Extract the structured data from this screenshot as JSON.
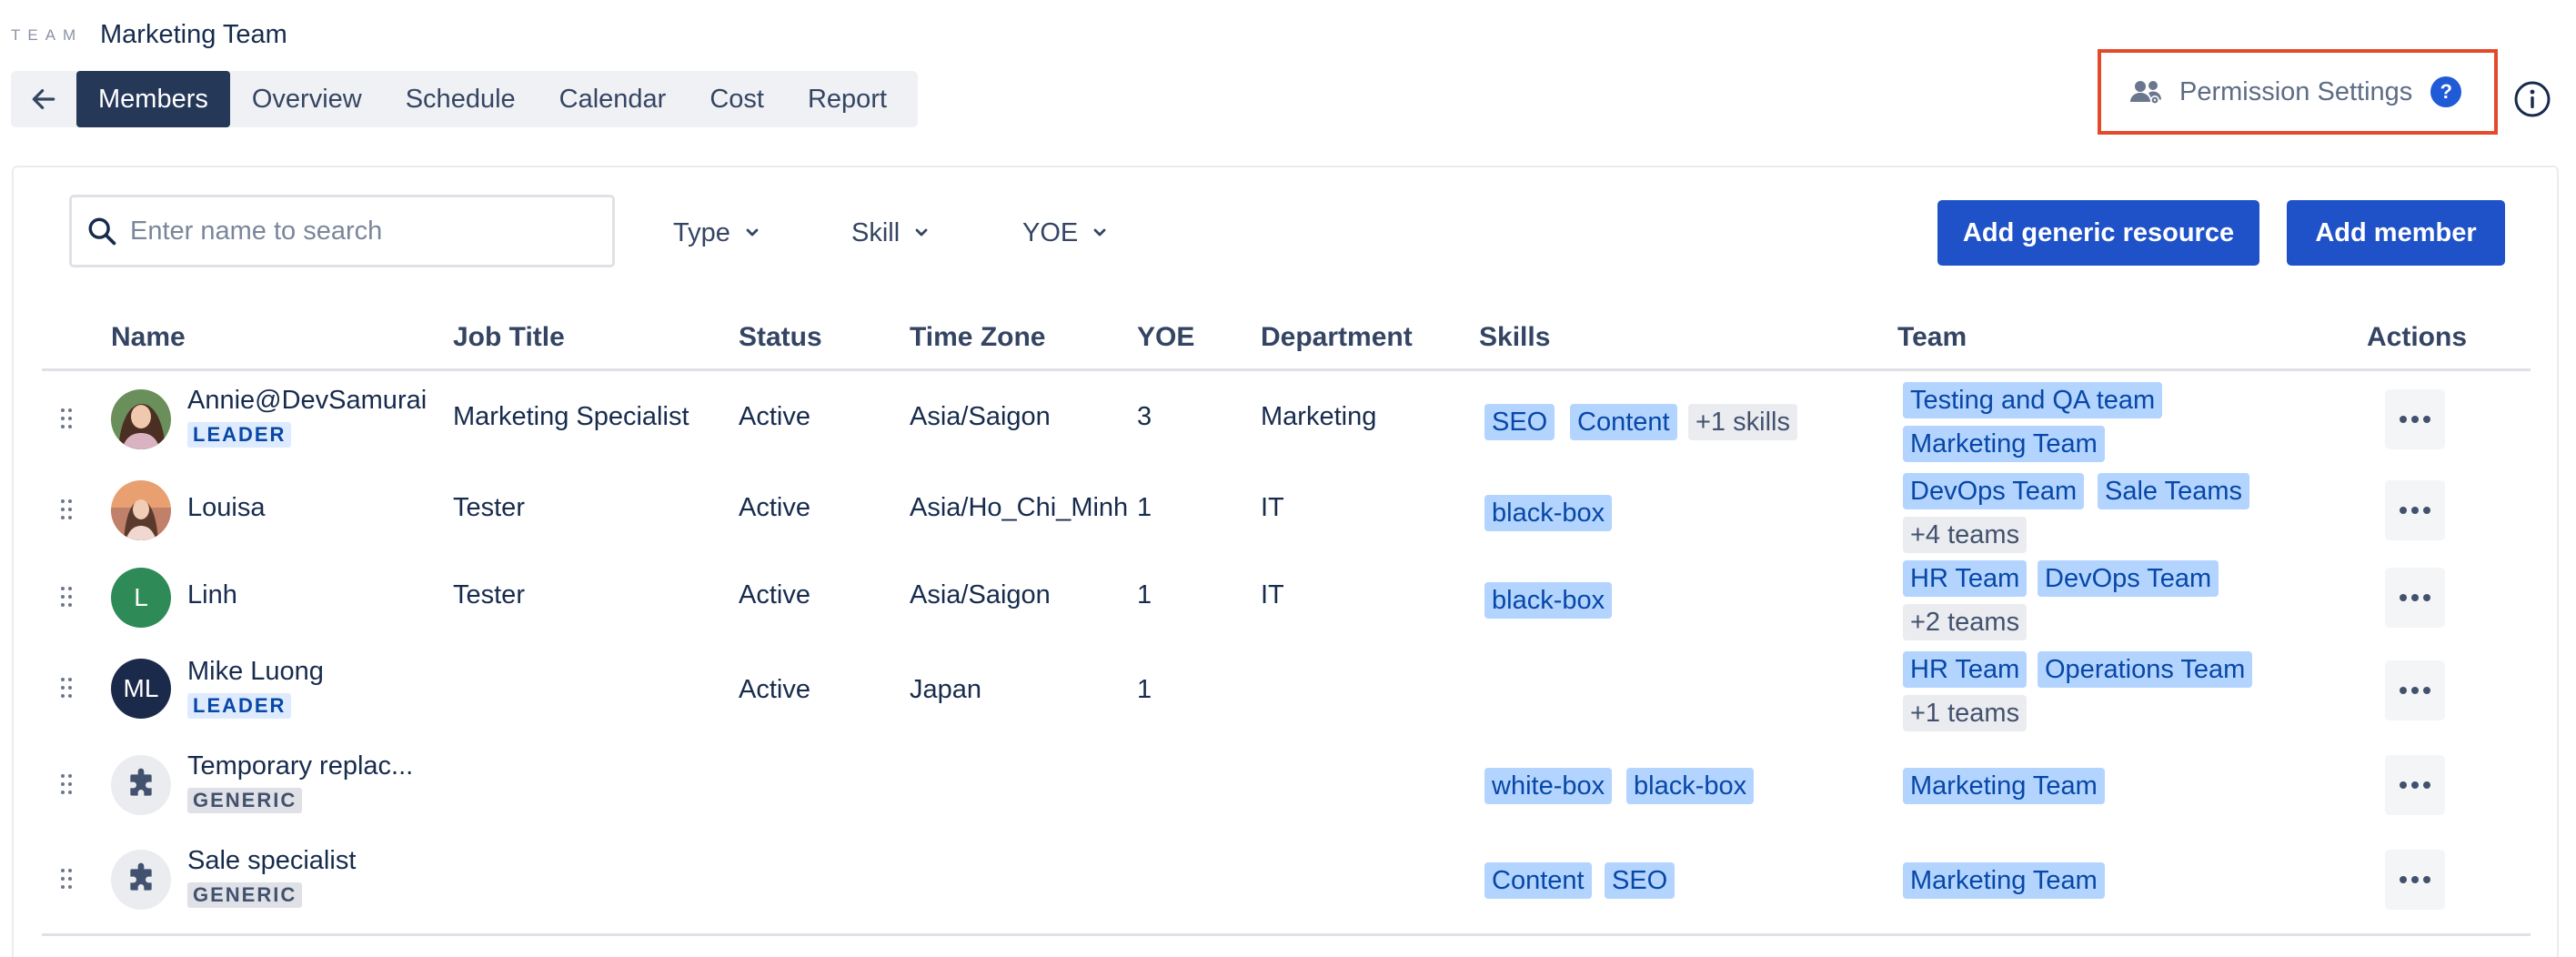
{
  "header": {
    "team_label": "TEAM",
    "team_name": "Marketing Team",
    "tabs": [
      {
        "label": "Members",
        "active": true
      },
      {
        "label": "Overview"
      },
      {
        "label": "Schedule"
      },
      {
        "label": "Calendar"
      },
      {
        "label": "Cost"
      },
      {
        "label": "Report"
      }
    ],
    "permission_settings_label": "Permission Settings",
    "help_badge": "?"
  },
  "toolbar": {
    "search_placeholder": "Enter name to search",
    "filters": [
      "Type",
      "Skill",
      "YOE"
    ],
    "add_generic_label": "Add generic resource",
    "add_member_label": "Add member"
  },
  "table": {
    "columns": [
      "Name",
      "Job Title",
      "Status",
      "Time Zone",
      "YOE",
      "Department",
      "Skills",
      "Team",
      "Actions"
    ],
    "rows": [
      {
        "name": "Annie@DevSamurai",
        "badge": "LEADER",
        "job_title": "Marketing Specialist",
        "status": "Active",
        "time_zone": "Asia/Saigon",
        "yoe": "3",
        "department": "Marketing",
        "skills": [
          "SEO",
          "Content"
        ],
        "skills_more": "+1 skills",
        "teams": [
          "Testing and QA team",
          "Marketing Team"
        ],
        "teams_more": ""
      },
      {
        "name": "Louisa",
        "badge": "",
        "job_title": "Tester",
        "status": "Active",
        "time_zone": "Asia/Ho_Chi_Minh",
        "yoe": "1",
        "department": "IT",
        "skills": [
          "black-box"
        ],
        "skills_more": "",
        "teams": [
          "DevOps Team",
          "Sale Teams"
        ],
        "teams_more": "+4 teams"
      },
      {
        "name": "Linh",
        "avatar_initial": "L",
        "badge": "",
        "job_title": "Tester",
        "status": "Active",
        "time_zone": "Asia/Saigon",
        "yoe": "1",
        "department": "IT",
        "skills": [
          "black-box"
        ],
        "skills_more": "",
        "teams": [
          "HR Team",
          "DevOps Team"
        ],
        "teams_more": "+2 teams"
      },
      {
        "name": "Mike Luong",
        "avatar_initial": "ML",
        "badge": "LEADER",
        "job_title": "",
        "status": "Active",
        "time_zone": "Japan",
        "yoe": "1",
        "department": "",
        "skills": [],
        "skills_more": "",
        "teams": [
          "HR Team",
          "Operations Team"
        ],
        "teams_more": "+1 teams"
      },
      {
        "name": "Temporary replac...",
        "badge": "GENERIC",
        "job_title": "",
        "status": "",
        "time_zone": "",
        "yoe": "",
        "department": "",
        "skills": [
          "white-box",
          "black-box"
        ],
        "skills_more": "",
        "teams": [
          "Marketing Team"
        ],
        "teams_more": ""
      },
      {
        "name": "Sale specialist",
        "badge": "GENERIC",
        "job_title": "",
        "status": "",
        "time_zone": "",
        "yoe": "",
        "department": "",
        "skills": [
          "Content",
          "SEO"
        ],
        "skills_more": "",
        "teams": [
          "Marketing Team"
        ],
        "teams_more": ""
      }
    ]
  },
  "colors": {
    "primary_button": "#1f52c8",
    "active_tab": "#253858",
    "highlight_border": "#e34a2c",
    "tag_blue": "#b3d4ff",
    "avatar_linh": "#2e8b57",
    "avatar_mike": "#1b2a4a"
  }
}
